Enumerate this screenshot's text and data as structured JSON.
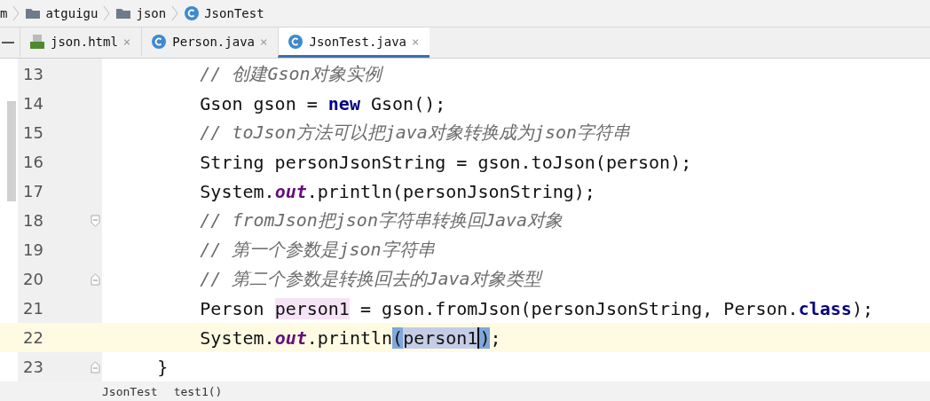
{
  "breadcrumbs": [
    {
      "label": "m",
      "kind": "module"
    },
    {
      "label": "atguigu",
      "kind": "folder"
    },
    {
      "label": "json",
      "kind": "folder"
    },
    {
      "label": "JsonTest",
      "kind": "class"
    }
  ],
  "tabs": [
    {
      "label": "json.html",
      "kind": "html",
      "selected": false,
      "close": "×"
    },
    {
      "label": "Person.java",
      "kind": "class",
      "selected": false,
      "close": "×"
    },
    {
      "label": "JsonTest.java",
      "kind": "class",
      "selected": true,
      "close": "×"
    }
  ],
  "editor": {
    "lines": [
      {
        "number": "13",
        "current": false,
        "fold_start": false,
        "fold_end": false,
        "tokens": [
          {
            "text": "        // 创建Gson对象实例",
            "kind": "comment"
          }
        ]
      },
      {
        "number": "14",
        "current": false,
        "fold_start": false,
        "fold_end": false,
        "tokens": [
          {
            "text": "        Gson gson = ",
            "kind": "plain"
          },
          {
            "text": "new",
            "kind": "keyword"
          },
          {
            "text": " Gson();",
            "kind": "plain"
          }
        ]
      },
      {
        "number": "15",
        "current": false,
        "fold_start": false,
        "fold_end": false,
        "tokens": [
          {
            "text": "        // toJson方法可以把java对象转换成为json字符串",
            "kind": "comment"
          }
        ]
      },
      {
        "number": "16",
        "current": false,
        "fold_start": false,
        "fold_end": false,
        "tokens": [
          {
            "text": "        String personJsonString = gson.toJson(person);",
            "kind": "plain"
          }
        ]
      },
      {
        "number": "17",
        "current": false,
        "fold_start": false,
        "fold_end": false,
        "tokens": [
          {
            "text": "        System.",
            "kind": "plain"
          },
          {
            "text": "out",
            "kind": "field"
          },
          {
            "text": ".println(personJsonString);",
            "kind": "plain"
          }
        ]
      },
      {
        "number": "18",
        "current": false,
        "fold_start": true,
        "fold_end": false,
        "tokens": [
          {
            "text": "        // fromJson把json字符串转换回Java对象",
            "kind": "comment"
          }
        ]
      },
      {
        "number": "19",
        "current": false,
        "fold_start": false,
        "fold_end": false,
        "tokens": [
          {
            "text": "        // 第一个参数是json字符串",
            "kind": "comment"
          }
        ]
      },
      {
        "number": "20",
        "current": false,
        "fold_start": false,
        "fold_end": true,
        "tokens": [
          {
            "text": "        // 第二个参数是转换回去的Java对象类型",
            "kind": "comment"
          }
        ]
      },
      {
        "number": "21",
        "current": false,
        "fold_start": false,
        "fold_end": false,
        "tokens": [
          {
            "text": "        Person ",
            "kind": "plain"
          },
          {
            "text": "person1",
            "kind": "usage"
          },
          {
            "text": " = gson.fromJson(personJsonString, Person.",
            "kind": "plain"
          },
          {
            "text": "class",
            "kind": "keyword"
          },
          {
            "text": ");",
            "kind": "plain"
          }
        ]
      },
      {
        "number": "22",
        "current": true,
        "fold_start": false,
        "fold_end": false,
        "tokens": [
          {
            "text": "        System.",
            "kind": "plain"
          },
          {
            "text": "out",
            "kind": "field"
          },
          {
            "text": ".println",
            "kind": "plain"
          },
          {
            "text": "(",
            "kind": "brace"
          },
          {
            "text": "person1",
            "kind": "selection"
          },
          {
            "text": ")",
            "kind": "brace"
          },
          {
            "text": ";",
            "kind": "plain"
          }
        ]
      },
      {
        "number": "23",
        "current": false,
        "fold_start": false,
        "fold_end": true,
        "tokens": [
          {
            "text": "    }",
            "kind": "plain"
          }
        ]
      }
    ]
  },
  "status_breadcrumbs": [
    "JsonTest",
    "test1()"
  ]
}
